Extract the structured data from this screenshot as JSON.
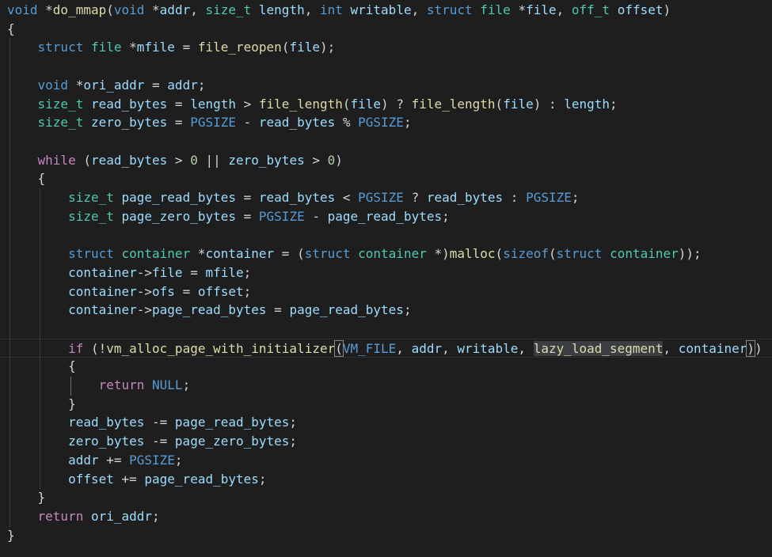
{
  "editor": {
    "background": "#1e1e1e",
    "lines": [
      [
        [
          "k",
          "void"
        ],
        [
          "p",
          " *"
        ],
        [
          "f",
          "do_mmap"
        ],
        [
          "p",
          "("
        ],
        [
          "k",
          "void"
        ],
        [
          "p",
          " *"
        ],
        [
          "v",
          "addr"
        ],
        [
          "p",
          ", "
        ],
        [
          "t",
          "size_t"
        ],
        [
          "p",
          " "
        ],
        [
          "v",
          "length"
        ],
        [
          "p",
          ", "
        ],
        [
          "k",
          "int"
        ],
        [
          "p",
          " "
        ],
        [
          "v",
          "writable"
        ],
        [
          "p",
          ", "
        ],
        [
          "k",
          "struct"
        ],
        [
          "p",
          " "
        ],
        [
          "t",
          "file"
        ],
        [
          "p",
          " *"
        ],
        [
          "v",
          "file"
        ],
        [
          "p",
          ", "
        ],
        [
          "t",
          "off_t"
        ],
        [
          "p",
          " "
        ],
        [
          "v",
          "offset"
        ],
        [
          "p",
          ")"
        ]
      ],
      [
        [
          "p",
          "{"
        ]
      ],
      [
        [
          "p",
          "    "
        ],
        [
          "k",
          "struct"
        ],
        [
          "p",
          " "
        ],
        [
          "t",
          "file"
        ],
        [
          "p",
          " *"
        ],
        [
          "v",
          "mfile"
        ],
        [
          "p",
          " = "
        ],
        [
          "f",
          "file_reopen"
        ],
        [
          "p",
          "("
        ],
        [
          "v",
          "file"
        ],
        [
          "p",
          ");"
        ]
      ],
      [],
      [
        [
          "p",
          "    "
        ],
        [
          "k",
          "void"
        ],
        [
          "p",
          " *"
        ],
        [
          "v",
          "ori_addr"
        ],
        [
          "p",
          " = "
        ],
        [
          "v",
          "addr"
        ],
        [
          "p",
          ";"
        ]
      ],
      [
        [
          "p",
          "    "
        ],
        [
          "t",
          "size_t"
        ],
        [
          "p",
          " "
        ],
        [
          "v",
          "read_bytes"
        ],
        [
          "p",
          " = "
        ],
        [
          "v",
          "length"
        ],
        [
          "p",
          " > "
        ],
        [
          "f",
          "file_length"
        ],
        [
          "p",
          "("
        ],
        [
          "v",
          "file"
        ],
        [
          "p",
          ") ? "
        ],
        [
          "f",
          "file_length"
        ],
        [
          "p",
          "("
        ],
        [
          "v",
          "file"
        ],
        [
          "p",
          ") : "
        ],
        [
          "v",
          "length"
        ],
        [
          "p",
          ";"
        ]
      ],
      [
        [
          "p",
          "    "
        ],
        [
          "t",
          "size_t"
        ],
        [
          "p",
          " "
        ],
        [
          "v",
          "zero_bytes"
        ],
        [
          "p",
          " = "
        ],
        [
          "m",
          "PGSIZE"
        ],
        [
          "p",
          " - "
        ],
        [
          "v",
          "read_bytes"
        ],
        [
          "p",
          " % "
        ],
        [
          "m",
          "PGSIZE"
        ],
        [
          "p",
          ";"
        ]
      ],
      [],
      [
        [
          "p",
          "    "
        ],
        [
          "c",
          "while"
        ],
        [
          "p",
          " ("
        ],
        [
          "v",
          "read_bytes"
        ],
        [
          "p",
          " > "
        ],
        [
          "n",
          "0"
        ],
        [
          "p",
          " || "
        ],
        [
          "v",
          "zero_bytes"
        ],
        [
          "p",
          " > "
        ],
        [
          "n",
          "0"
        ],
        [
          "p",
          ")"
        ]
      ],
      [
        [
          "p",
          "    {"
        ]
      ],
      [
        [
          "p",
          "        "
        ],
        [
          "t",
          "size_t"
        ],
        [
          "p",
          " "
        ],
        [
          "v",
          "page_read_bytes"
        ],
        [
          "p",
          " = "
        ],
        [
          "v",
          "read_bytes"
        ],
        [
          "p",
          " < "
        ],
        [
          "m",
          "PGSIZE"
        ],
        [
          "p",
          " ? "
        ],
        [
          "v",
          "read_bytes"
        ],
        [
          "p",
          " : "
        ],
        [
          "m",
          "PGSIZE"
        ],
        [
          "p",
          ";"
        ]
      ],
      [
        [
          "p",
          "        "
        ],
        [
          "t",
          "size_t"
        ],
        [
          "p",
          " "
        ],
        [
          "v",
          "page_zero_bytes"
        ],
        [
          "p",
          " = "
        ],
        [
          "m",
          "PGSIZE"
        ],
        [
          "p",
          " - "
        ],
        [
          "v",
          "page_read_bytes"
        ],
        [
          "p",
          ";"
        ]
      ],
      [],
      [
        [
          "p",
          "        "
        ],
        [
          "k",
          "struct"
        ],
        [
          "p",
          " "
        ],
        [
          "t",
          "container"
        ],
        [
          "p",
          " *"
        ],
        [
          "v",
          "container"
        ],
        [
          "p",
          " = ("
        ],
        [
          "k",
          "struct"
        ],
        [
          "p",
          " "
        ],
        [
          "t",
          "container"
        ],
        [
          "p",
          " *)"
        ],
        [
          "f",
          "malloc"
        ],
        [
          "p",
          "("
        ],
        [
          "k",
          "sizeof"
        ],
        [
          "p",
          "("
        ],
        [
          "k",
          "struct"
        ],
        [
          "p",
          " "
        ],
        [
          "t",
          "container"
        ],
        [
          "p",
          "));"
        ]
      ],
      [
        [
          "p",
          "        "
        ],
        [
          "v",
          "container"
        ],
        [
          "p",
          "->"
        ],
        [
          "v",
          "file"
        ],
        [
          "p",
          " = "
        ],
        [
          "v",
          "mfile"
        ],
        [
          "p",
          ";"
        ]
      ],
      [
        [
          "p",
          "        "
        ],
        [
          "v",
          "container"
        ],
        [
          "p",
          "->"
        ],
        [
          "v",
          "ofs"
        ],
        [
          "p",
          " = "
        ],
        [
          "v",
          "offset"
        ],
        [
          "p",
          ";"
        ]
      ],
      [
        [
          "p",
          "        "
        ],
        [
          "v",
          "container"
        ],
        [
          "p",
          "->"
        ],
        [
          "v",
          "page_read_bytes"
        ],
        [
          "p",
          " = "
        ],
        [
          "v",
          "page_read_bytes"
        ],
        [
          "p",
          ";"
        ]
      ],
      [],
      [
        [
          "p",
          "        "
        ],
        [
          "c",
          "if"
        ],
        [
          "p",
          " (!"
        ],
        [
          "f",
          "vm_alloc_page_with_initializer"
        ],
        [
          "p br",
          "("
        ],
        [
          "m",
          "VM_FILE"
        ],
        [
          "p",
          ", "
        ],
        [
          "v",
          "addr"
        ],
        [
          "p",
          ", "
        ],
        [
          "v",
          "writable"
        ],
        [
          "p",
          ", "
        ],
        [
          "f hl",
          "lazy_load_segment"
        ],
        [
          "p",
          ", "
        ],
        [
          "v",
          "container"
        ],
        [
          "p br",
          ")"
        ],
        [
          "p",
          ")"
        ]
      ],
      [
        [
          "p",
          "        {"
        ]
      ],
      [
        [
          "p",
          "            "
        ],
        [
          "c",
          "return"
        ],
        [
          "p",
          " "
        ],
        [
          "m",
          "NULL"
        ],
        [
          "p",
          ";"
        ]
      ],
      [
        [
          "p",
          "        }"
        ]
      ],
      [
        [
          "p",
          "        "
        ],
        [
          "v",
          "read_bytes"
        ],
        [
          "p",
          " -= "
        ],
        [
          "v",
          "page_read_bytes"
        ],
        [
          "p",
          ";"
        ]
      ],
      [
        [
          "p",
          "        "
        ],
        [
          "v",
          "zero_bytes"
        ],
        [
          "p",
          " -= "
        ],
        [
          "v",
          "page_zero_bytes"
        ],
        [
          "p",
          ";"
        ]
      ],
      [
        [
          "p",
          "        "
        ],
        [
          "v",
          "addr"
        ],
        [
          "p",
          " += "
        ],
        [
          "m",
          "PGSIZE"
        ],
        [
          "p",
          ";"
        ]
      ],
      [
        [
          "p",
          "        "
        ],
        [
          "v",
          "offset"
        ],
        [
          "p",
          " += "
        ],
        [
          "v",
          "page_read_bytes"
        ],
        [
          "p",
          ";"
        ]
      ],
      [
        [
          "p",
          "    }"
        ]
      ],
      [
        [
          "p",
          "    "
        ],
        [
          "c",
          "return"
        ],
        [
          "p",
          " "
        ],
        [
          "v",
          "ori_addr"
        ],
        [
          "p",
          ";"
        ]
      ],
      [
        [
          "p",
          "}"
        ]
      ]
    ]
  }
}
